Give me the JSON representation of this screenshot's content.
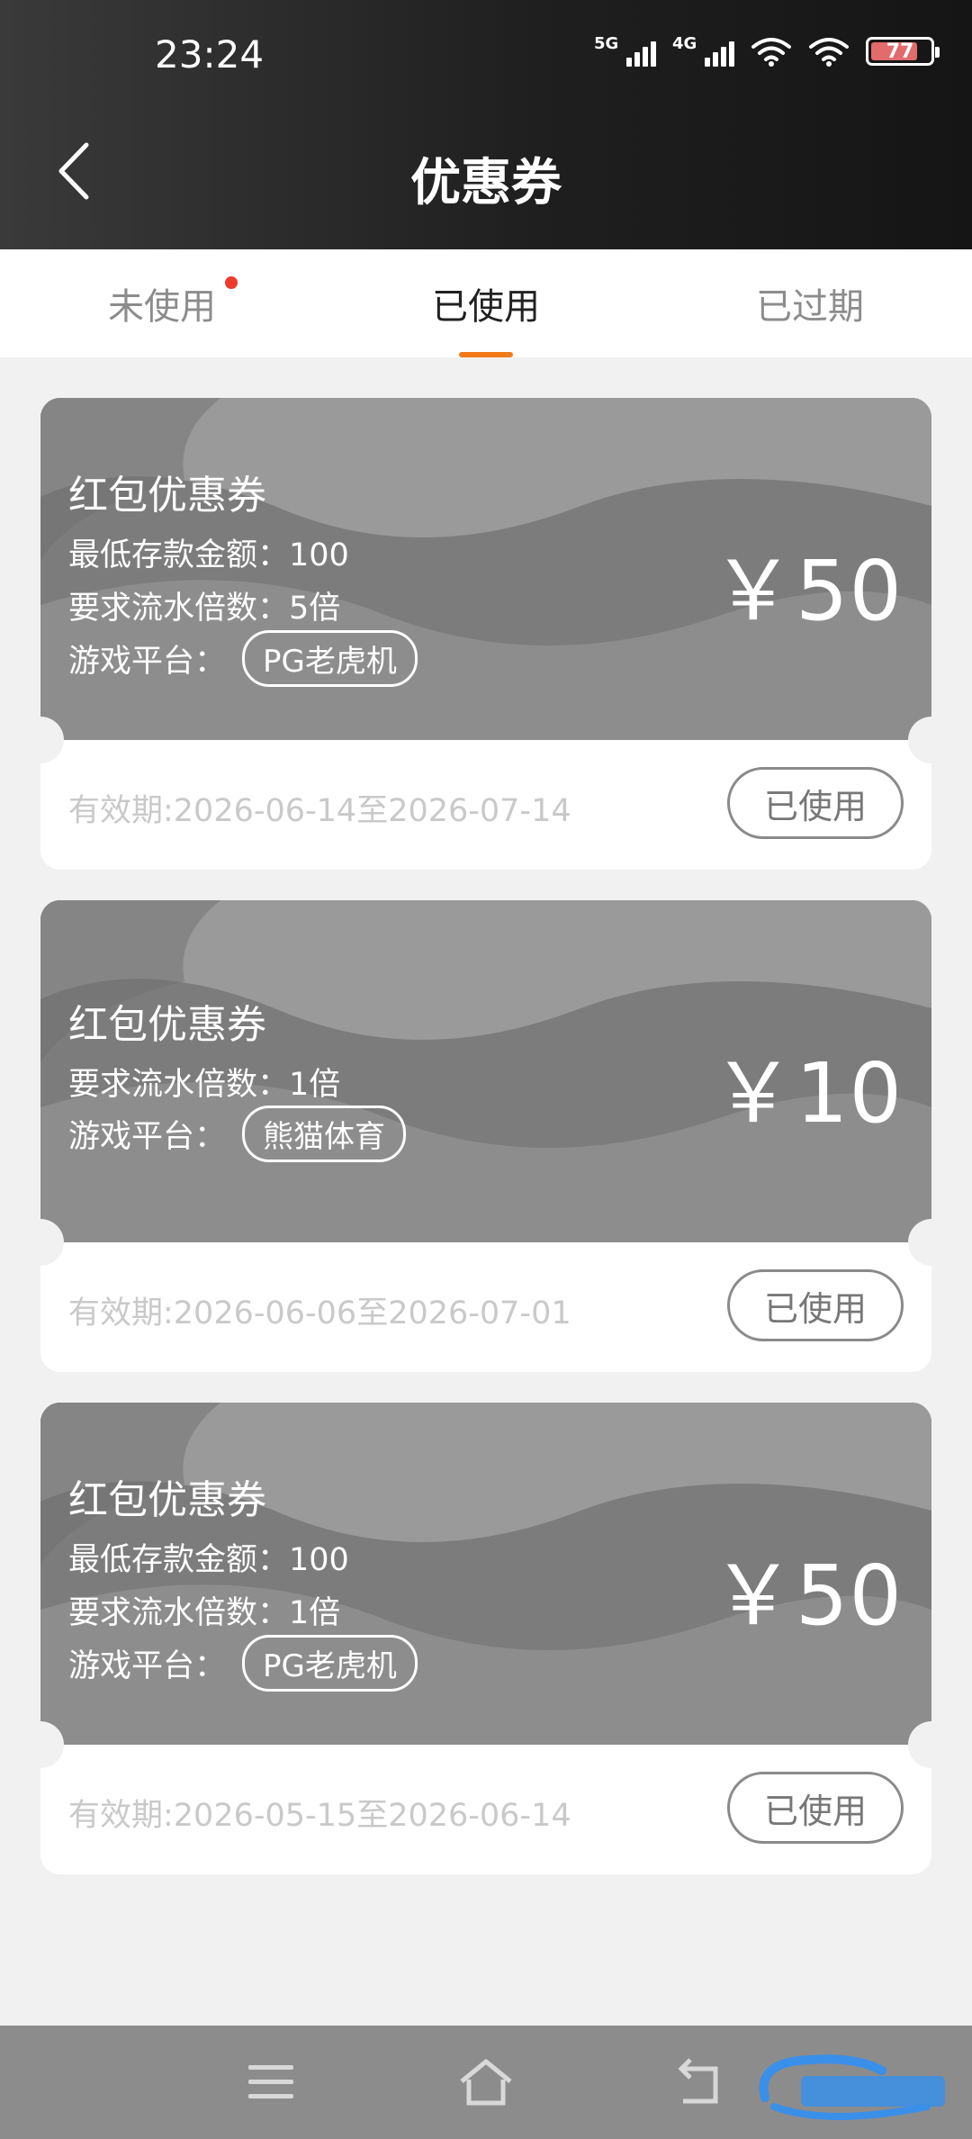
{
  "status_bar": {
    "time": "23:24",
    "net1": "5G",
    "net2": "4G",
    "battery": "77"
  },
  "header": {
    "title": "优惠券",
    "back_icon": "chevron-left-icon"
  },
  "tabs": [
    {
      "label": "未使用",
      "has_dot": true
    },
    {
      "label": "已使用",
      "active": true
    },
    {
      "label": "已过期"
    }
  ],
  "coupons": [
    {
      "title": "红包优惠券",
      "min_deposit": "最低存款金额：100",
      "wager": "要求流水倍数：5倍",
      "platform_label": "游戏平台：",
      "platform": "PG老虎机",
      "amount": "￥50",
      "validity": "有效期:2026-06-14至2026-07-14",
      "status": "已使用"
    },
    {
      "title": "红包优惠券",
      "wager": "要求流水倍数：1倍",
      "platform_label": "游戏平台：",
      "platform": "熊猫体育",
      "amount": "￥10",
      "validity": "有效期:2026-06-06至2026-07-01",
      "status": "已使用"
    },
    {
      "title": "红包优惠券",
      "min_deposit": "最低存款金额：100",
      "wager": "要求流水倍数：1倍",
      "platform_label": "游戏平台：",
      "platform": "PG老虎机",
      "amount": "￥50",
      "validity": "有效期:2026-05-15至2026-06-14",
      "status": "已使用"
    }
  ],
  "colors": {
    "accent": "#f07a1a",
    "dot": "#ee3a2a",
    "coupon_bg": "#8a8a8a"
  },
  "nav": {
    "menu_icon": "menu-icon",
    "home_icon": "home-icon",
    "back_icon": "back-icon"
  }
}
